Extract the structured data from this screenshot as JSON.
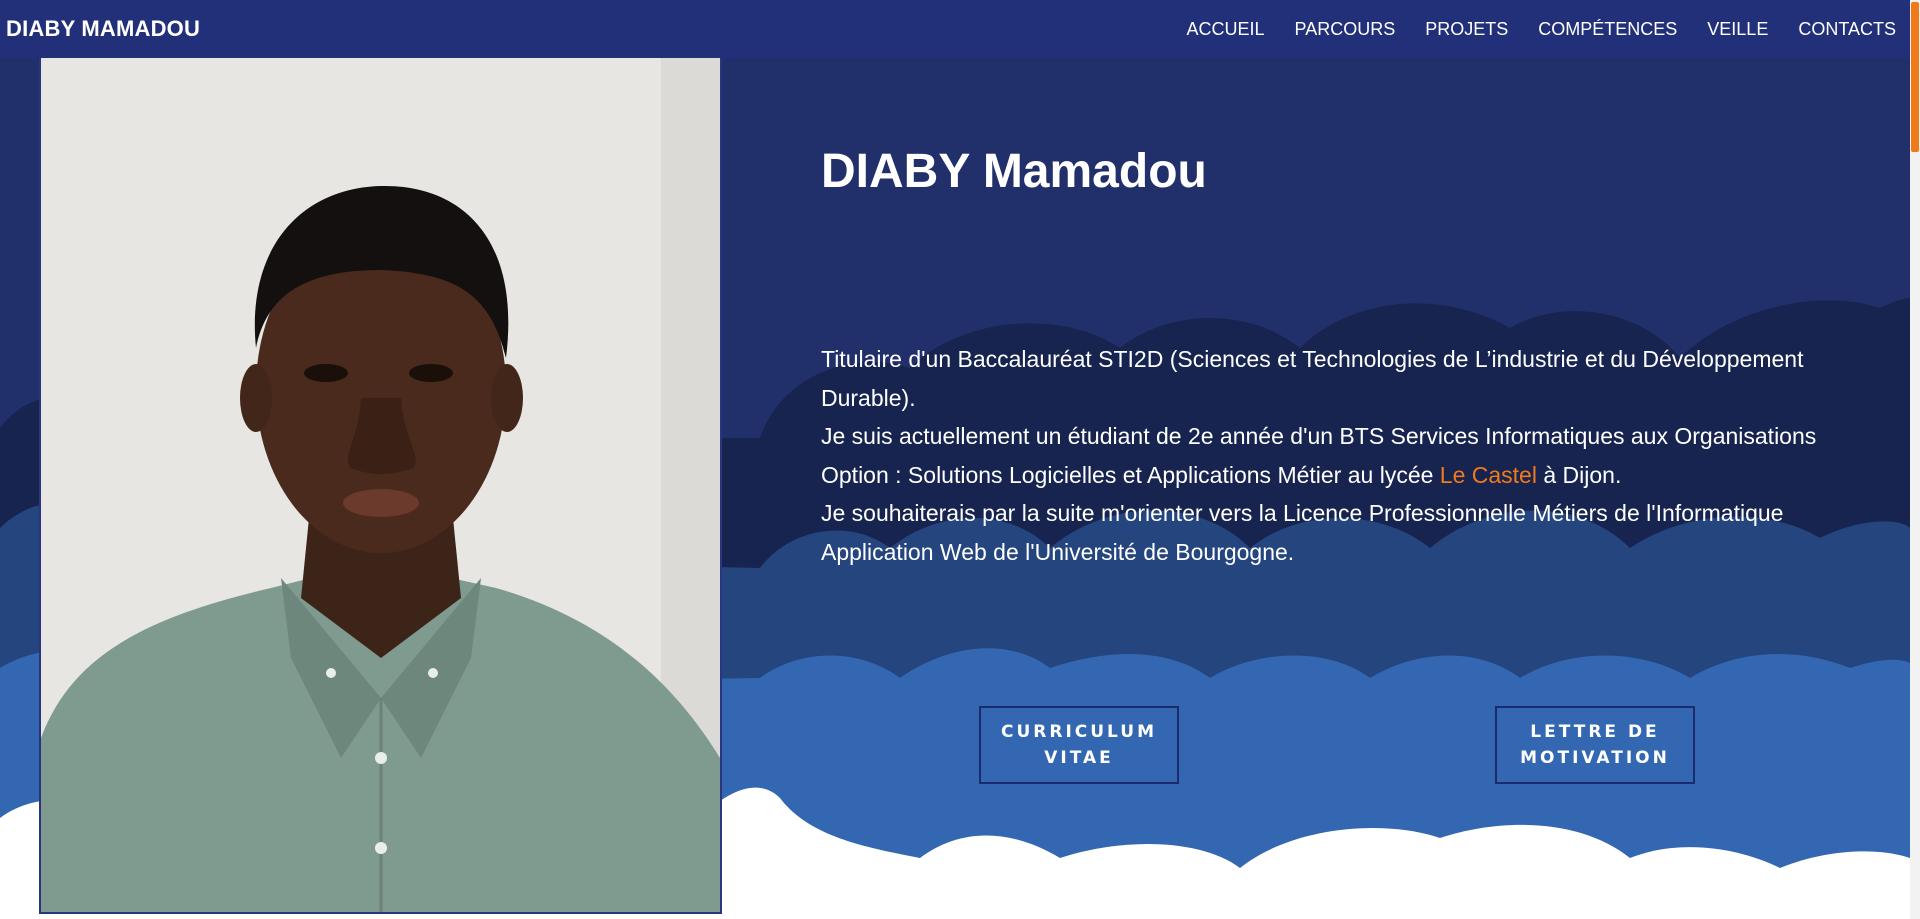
{
  "colors": {
    "navbar": "#22307a",
    "background": "#21306a",
    "accent": "#f07a1a",
    "cloud_dark": "#17244f",
    "cloud_mid": "#24457e",
    "cloud_light": "#3367b2",
    "cloud_white": "#ffffff"
  },
  "header": {
    "brand": "DIABY MAMADOU",
    "nav": [
      "ACCUEIL",
      "PARCOURS",
      "PROJETS",
      "COMPÉTENCES",
      "VEILLE",
      "CONTACTS"
    ]
  },
  "hero": {
    "title": "DIABY Mamadou",
    "bio": {
      "line1": "Titulaire d'un Baccalauréat STI2D (Sciences et Technologies de L’industrie et du Développement Durable).",
      "line2_before": "Je suis actuellement un étudiant de 2e année d'un BTS Services Informatiques aux Organisations Option : Solutions Logicielles et Applications Métier au lycée ",
      "school_link": "Le Castel",
      "line2_after": " à Dijon.",
      "line3": "Je souhaiterais par la suite m'orienter vers la Licence Professionnelle Métiers de l'Informatique Application Web de l'Université de Bourgogne."
    },
    "buttons": {
      "cv_line1": "CURRICULUM",
      "cv_line2": "VITAE",
      "letter_line1": "LETTRE DE",
      "letter_line2": "MOTIVATION"
    },
    "photo_icon": "person-portrait"
  }
}
